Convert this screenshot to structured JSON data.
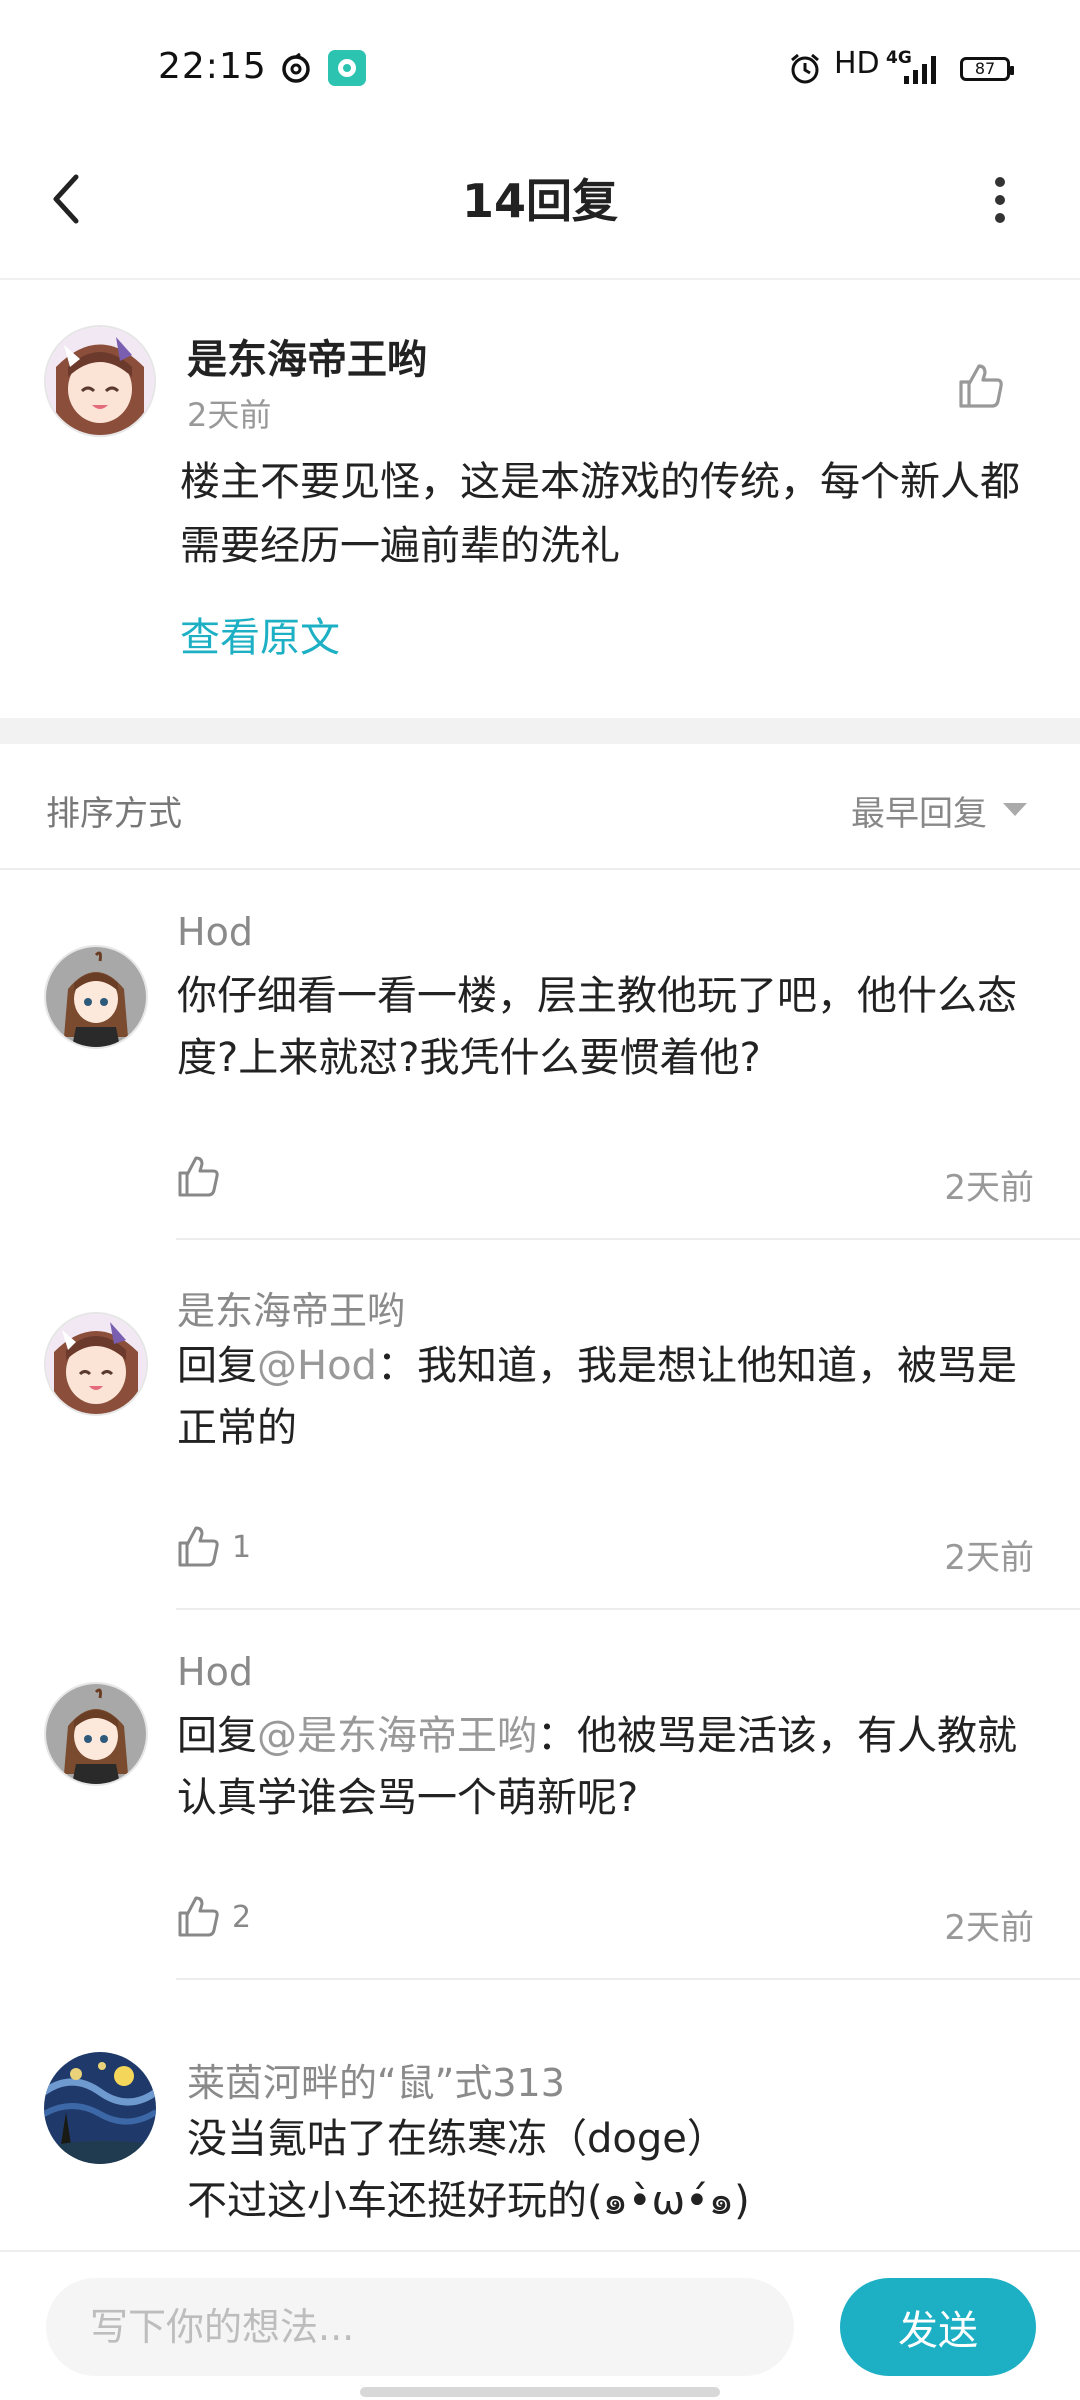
{
  "status_bar": {
    "time": "22:15",
    "network": "HD",
    "signal": "4G",
    "battery": "87",
    "icons": [
      "netease-music-icon",
      "app-notification-icon",
      "alarm-icon",
      "signal-icon"
    ]
  },
  "header": {
    "title": "14回复"
  },
  "op": {
    "author": "是东海帝王哟",
    "time": "2天前",
    "text": "楼主不要见怪，这是本游戏的传统，每个新人都需要经历一遍前辈的洗礼",
    "view_original": "查看原文"
  },
  "sort": {
    "label": "排序方式",
    "value": "最早回复"
  },
  "comments": [
    {
      "author": "Hod",
      "prefix": "",
      "mention": "",
      "text": "你仔细看一看一楼，层主教他玩了吧，他什么态度?上来就怼?我凭什么要惯着他?",
      "likes": "",
      "time": "2天前"
    },
    {
      "author": "是东海帝王哟",
      "prefix": "回复",
      "mention": "@Hod",
      "text": "：我知道，我是想让他知道，被骂是正常的",
      "likes": "1",
      "time": "2天前"
    },
    {
      "author": "Hod",
      "prefix": "回复",
      "mention": "@是东海帝王哟",
      "text": "：他被骂是活该，有人教就认真学谁会骂一个萌新呢?",
      "likes": "2",
      "time": "2天前"
    },
    {
      "author": "莱茵河畔的“鼠”式313",
      "line1": "没当氪咕了在练寒冻（doge）",
      "line2": "不过这小车还挺好玩的(๑•̀ω•́๑)"
    }
  ],
  "input": {
    "placeholder": "写下你的想法...",
    "send_label": "发送"
  },
  "colors": {
    "accent": "#1db0c4",
    "muted": "#999999"
  }
}
